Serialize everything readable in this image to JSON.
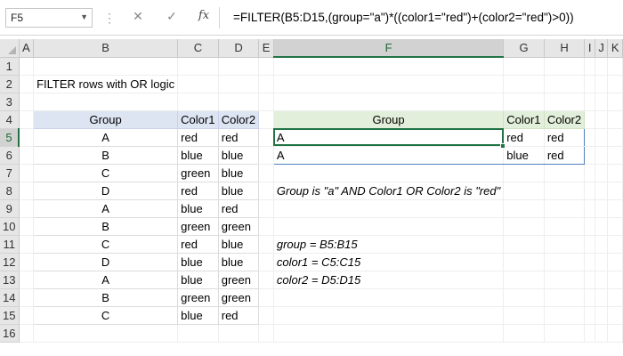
{
  "formula_bar": {
    "name_box": "F5",
    "cancel_icon": "✕",
    "enter_icon": "✓",
    "fx_label": "fx",
    "formula": "=FILTER(B5:D15,(group=\"a\")*((color1=\"red\")+(color2=\"red\")>0))"
  },
  "columns": [
    "A",
    "B",
    "C",
    "D",
    "E",
    "F",
    "G",
    "H",
    "I",
    "J",
    "K"
  ],
  "rows": [
    "1",
    "2",
    "3",
    "4",
    "5",
    "6",
    "7",
    "8",
    "9",
    "10",
    "11",
    "12",
    "13",
    "14",
    "15",
    "16"
  ],
  "title": "FILTER rows with OR logic",
  "source_table": {
    "headers": [
      "Group",
      "Color1",
      "Color2"
    ],
    "rows": [
      [
        "A",
        "red",
        "red"
      ],
      [
        "B",
        "blue",
        "blue"
      ],
      [
        "C",
        "green",
        "blue"
      ],
      [
        "D",
        "red",
        "blue"
      ],
      [
        "A",
        "blue",
        "red"
      ],
      [
        "B",
        "green",
        "green"
      ],
      [
        "C",
        "red",
        "blue"
      ],
      [
        "D",
        "blue",
        "blue"
      ],
      [
        "A",
        "blue",
        "green"
      ],
      [
        "B",
        "green",
        "green"
      ],
      [
        "C",
        "blue",
        "red"
      ]
    ]
  },
  "output_table": {
    "headers": [
      "Group",
      "Color1",
      "Color2"
    ],
    "rows": [
      [
        "A",
        "red",
        "red"
      ],
      [
        "A",
        "blue",
        "red"
      ]
    ]
  },
  "note": "Group is \"a\" AND Color1 OR Color2 is \"red\"",
  "named_ranges": [
    "group = B5:B15",
    "color1 = C5:C15",
    "color2 = D5:D15"
  ],
  "colors": {
    "source_header_bg": "#dde5f3",
    "output_header_bg": "#e2efda",
    "selection": "#217346",
    "spill_border": "#4f81bd"
  }
}
